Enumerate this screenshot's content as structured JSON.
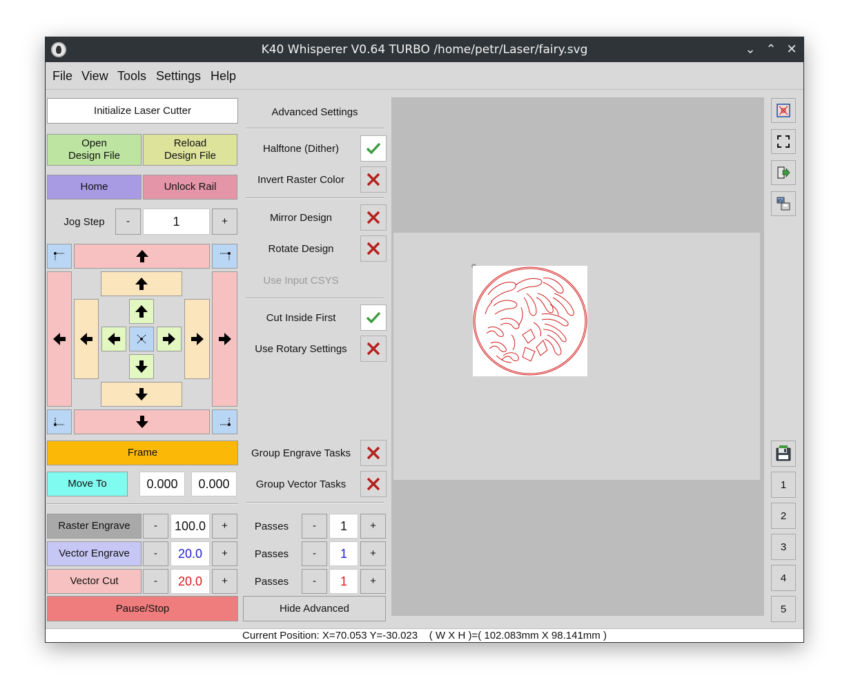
{
  "window": {
    "title": "K40 Whisperer V0.64 TURBO /home/petr/Laser/fairy.svg"
  },
  "menu": [
    "File",
    "View",
    "Tools",
    "Settings",
    "Help"
  ],
  "left": {
    "init": "Initialize Laser Cutter",
    "open": [
      "Open",
      "Design File"
    ],
    "reload": [
      "Reload",
      "Design File"
    ],
    "home": "Home",
    "unlock": "Unlock Rail",
    "jog_label": "Jog Step",
    "jog_minus": "-",
    "jog_value": "1",
    "jog_plus": "+",
    "frame": "Frame",
    "move_to": "Move To",
    "move_x": "0.000",
    "move_y": "0.000",
    "raster": {
      "label": "Raster Engrave",
      "minus": "-",
      "value": "100.0",
      "plus": "+"
    },
    "vector_engrave": {
      "label": "Vector Engrave",
      "minus": "-",
      "value": "20.0",
      "plus": "+"
    },
    "vector_cut": {
      "label": "Vector Cut",
      "minus": "-",
      "value": "20.0",
      "plus": "+"
    },
    "pause": "Pause/Stop"
  },
  "middle": {
    "advanced_title": "Advanced Settings",
    "halftone": "Halftone (Dither)",
    "invert": "Invert Raster Color",
    "mirror": "Mirror Design",
    "rotate": "Rotate Design",
    "input_csys": "Use Input CSYS",
    "cut_inside": "Cut Inside First",
    "rotary": "Use Rotary Settings",
    "group_engrave": "Group Engrave Tasks",
    "group_vector": "Group Vector Tasks",
    "passes": [
      {
        "label": "Passes",
        "minus": "-",
        "value": "1",
        "plus": "+"
      },
      {
        "label": "Passes",
        "minus": "-",
        "value": "1",
        "plus": "+"
      },
      {
        "label": "Passes",
        "minus": "-",
        "value": "1",
        "plus": "+"
      }
    ],
    "hide_advanced": "Hide Advanced"
  },
  "right": {
    "numbers": [
      "1",
      "2",
      "3",
      "4",
      "5"
    ]
  },
  "status": {
    "text": "Current Position: X=70.053 Y=-30.023    ( W X H )=( 102.083mm X 98.141mm )"
  },
  "colors": {
    "raster": "#a9a9a9",
    "vector_engrave": "#c7c7f5",
    "vector_cut": "#f7c1c1",
    "blue_value": "#1d1dd1",
    "red_value": "#e01818",
    "frame": "#fbb806",
    "pause": "#ef7d7d",
    "open": "#bde4a0",
    "reload": "#dde39b",
    "home": "#a89ae3",
    "unlock": "#e496a8"
  }
}
